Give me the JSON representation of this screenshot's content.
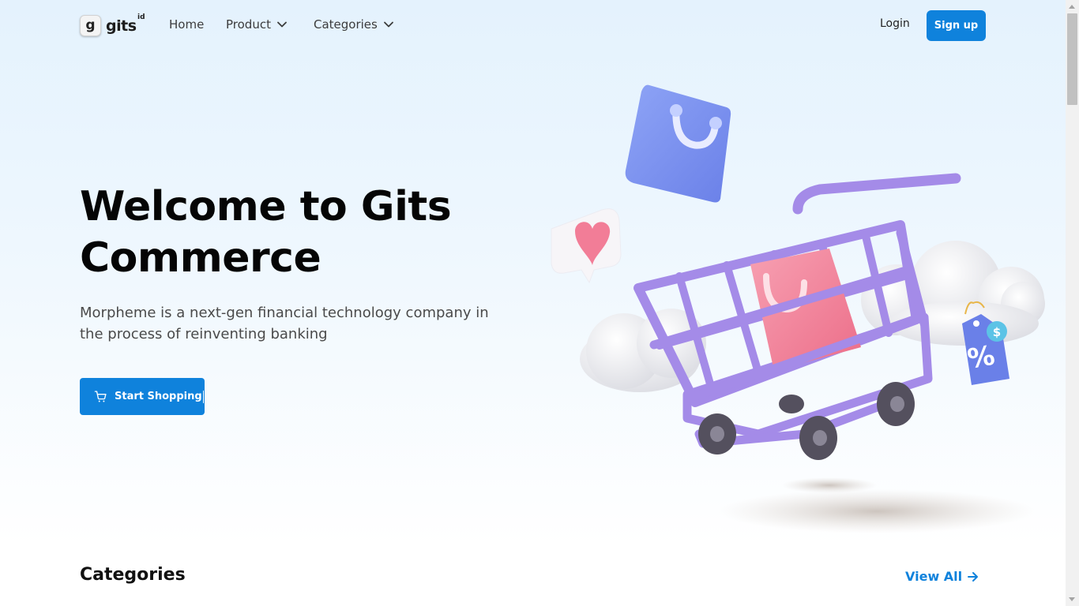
{
  "nav": {
    "logo_letter": "g",
    "logo_text": "gits",
    "logo_sup": "id",
    "links": [
      {
        "label": "Home"
      },
      {
        "label": "Product"
      },
      {
        "label": "Categories"
      }
    ],
    "login_label": "Login",
    "signup_label": "Sign up"
  },
  "hero": {
    "title_line1": "Welcome to Gits",
    "title_line2": "Commerce",
    "description": "Morpheme is a next-gen financial technology company in the process of reinventing banking",
    "cta_label": "Start Shopping",
    "cta_icon": "cart-icon"
  },
  "illustration": {
    "tag_dollar": "$",
    "tag_percent": "%"
  },
  "categories": {
    "title": "Categories",
    "view_all_label": "View All"
  },
  "colors": {
    "accent": "#0f82dc",
    "cart": "#a48be8",
    "bag_blue": "#7c93f0",
    "bag_pink": "#f27d97"
  }
}
